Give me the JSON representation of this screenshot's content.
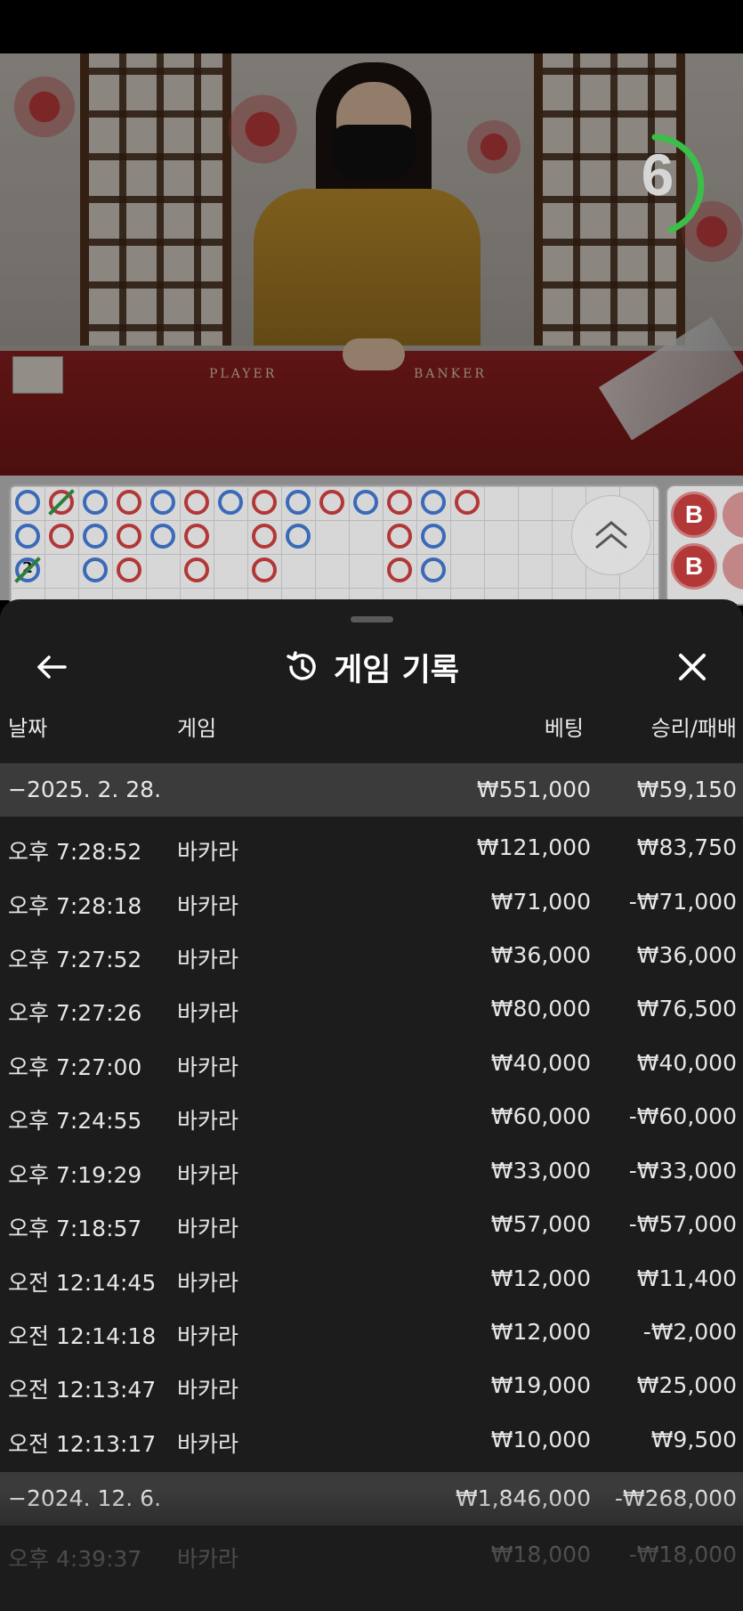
{
  "stream": {
    "countdown": "6",
    "table_labels": {
      "player": "PLAYER",
      "banker": "BANKER"
    }
  },
  "roadmap": {
    "tie_count": "2",
    "bead_road": [
      "B",
      "B"
    ]
  },
  "sheet": {
    "title": "게임 기록",
    "columns": {
      "date": "날짜",
      "game": "게임",
      "bet": "베팅",
      "result": "승리/패배"
    },
    "groups": [
      {
        "date": "−2025. 2. 28.",
        "total_bet": "₩551,000",
        "total_result": "₩59,150",
        "rows": [
          {
            "time": "오후 7:28:52",
            "game": "바카라",
            "bet": "₩121,000",
            "result": "₩83,750"
          },
          {
            "time": "오후 7:28:18",
            "game": "바카라",
            "bet": "₩71,000",
            "result": "-₩71,000"
          },
          {
            "time": "오후 7:27:52",
            "game": "바카라",
            "bet": "₩36,000",
            "result": "₩36,000"
          },
          {
            "time": "오후 7:27:26",
            "game": "바카라",
            "bet": "₩80,000",
            "result": "₩76,500"
          },
          {
            "time": "오후 7:27:00",
            "game": "바카라",
            "bet": "₩40,000",
            "result": "₩40,000"
          },
          {
            "time": "오후 7:24:55",
            "game": "바카라",
            "bet": "₩60,000",
            "result": "-₩60,000"
          },
          {
            "time": "오후 7:19:29",
            "game": "바카라",
            "bet": "₩33,000",
            "result": "-₩33,000"
          },
          {
            "time": "오후 7:18:57",
            "game": "바카라",
            "bet": "₩57,000",
            "result": "-₩57,000"
          },
          {
            "time": "오전 12:14:45",
            "game": "바카라",
            "bet": "₩12,000",
            "result": "₩11,400"
          },
          {
            "time": "오전 12:14:18",
            "game": "바카라",
            "bet": "₩12,000",
            "result": "-₩2,000"
          },
          {
            "time": "오전 12:13:47",
            "game": "바카라",
            "bet": "₩19,000",
            "result": "₩25,000"
          },
          {
            "time": "오전 12:13:17",
            "game": "바카라",
            "bet": "₩10,000",
            "result": "₩9,500"
          }
        ]
      },
      {
        "date": "−2024. 12. 6.",
        "total_bet": "₩1,846,000",
        "total_result": "-₩268,000",
        "rows": [
          {
            "time": "오후 4:39:37",
            "game": "바카라",
            "bet": "₩18,000",
            "result": "-₩18,000"
          }
        ]
      }
    ]
  },
  "icons": {
    "back": "arrow-left-icon",
    "history": "history-clock-icon",
    "close": "close-icon",
    "scroll_up": "double-chevron-up-icon"
  },
  "colors": {
    "banker_red": "#b23737",
    "player_blue": "#3a6ab8",
    "tie_green": "#2e7d3a",
    "timer_green": "#3bbf4a",
    "sheet_bg": "#1c1c1c",
    "group_row_bg": "#3b3b3b"
  }
}
